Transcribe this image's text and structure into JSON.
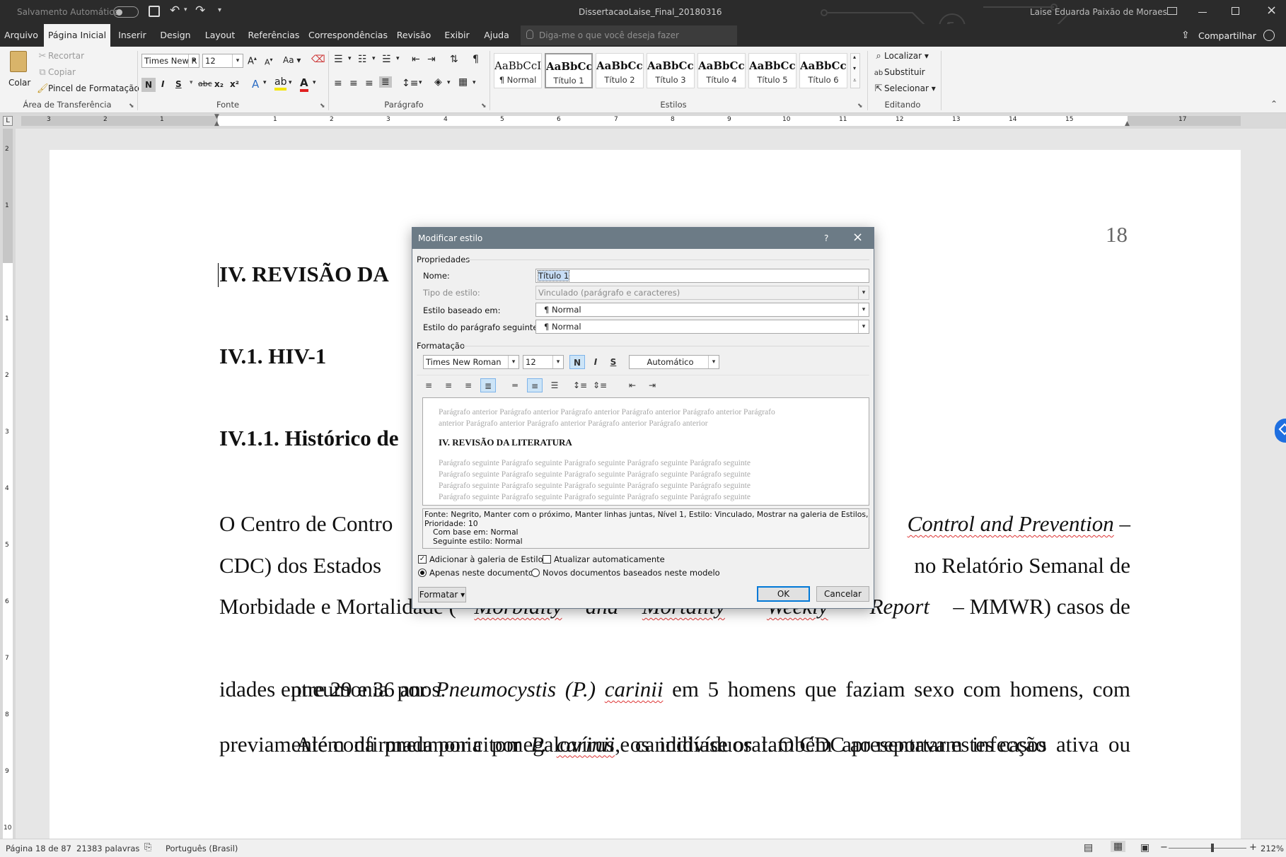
{
  "titlebar": {
    "autosave_label": "Salvamento Automático",
    "autosave_state": "off",
    "doc_title": "DissertacaoLaise_Final_20180316",
    "user_name": "Laise Eduarda Paixão de Moraes"
  },
  "tabs": [
    {
      "label": "Arquivo"
    },
    {
      "label": "Página Inicial"
    },
    {
      "label": "Inserir"
    },
    {
      "label": "Design"
    },
    {
      "label": "Layout"
    },
    {
      "label": "Referências"
    },
    {
      "label": "Correspondências"
    },
    {
      "label": "Revisão"
    },
    {
      "label": "Exibir"
    },
    {
      "label": "Ajuda"
    }
  ],
  "tellme_placeholder": "Diga-me o que você deseja fazer",
  "share_label": "Compartilhar",
  "ribbon": {
    "clipboard": {
      "paste": "Colar",
      "cut": "Recortar",
      "copy": "Copiar",
      "format_painter": "Pincel de Formatação",
      "group": "Área de Transferência"
    },
    "font": {
      "name": "Times New R",
      "size": "12",
      "group": "Fonte",
      "bold": "N",
      "italic": "I",
      "underline": "S",
      "strike": "abc",
      "sub": "x₂",
      "sup": "x²",
      "change_case": "Aa"
    },
    "paragraph": {
      "group": "Parágrafo"
    },
    "styles": {
      "group": "Estilos",
      "items": [
        {
          "preview": "AaBbCcI",
          "name": "¶ Normal"
        },
        {
          "preview": "AaBbCcl",
          "name": "Título 1"
        },
        {
          "preview": "AaBbCcl",
          "name": "Título 2"
        },
        {
          "preview": "AaBbCcl",
          "name": "Título 3"
        },
        {
          "preview": "AaBbCcl",
          "name": "Título 4"
        },
        {
          "preview": "AaBbCcl",
          "name": "Título 5"
        },
        {
          "preview": "AaBbCcl",
          "name": "Título 6"
        }
      ]
    },
    "editing": {
      "group": "Editando",
      "find": "Localizar",
      "replace": "Substituir",
      "select": "Selecionar"
    }
  },
  "ruler": {
    "marks": [
      "3",
      "2",
      "1",
      "1",
      "2",
      "3",
      "4",
      "5",
      "6",
      "7",
      "8",
      "9",
      "10",
      "11",
      "12",
      "13",
      "14",
      "15",
      "17"
    ]
  },
  "vruler": {
    "marks": [
      "2",
      "1",
      "1",
      "2",
      "3",
      "4",
      "5",
      "6",
      "7",
      "8",
      "9",
      "10"
    ]
  },
  "document": {
    "page_number": "18",
    "h1": "IV. REVISÃO DA",
    "h2": "IV.1. HIV-1",
    "h3": "IV.1.1. Histórico de",
    "p1_l1_a": "O Centro de Contro",
    "p1_l1_b": "Control and Prevention",
    "p1_l1_c": " –",
    "p1_l2_a": "CDC) dos Estados",
    "p1_l2_b": "no Relatório Semanal de",
    "p1_l3": [
      "Morbidade e Mortalidade (",
      "Morbidity",
      " and ",
      "Mortality",
      " ",
      "Weekly",
      " ",
      "Report",
      " – MMWR) casos de"
    ],
    "p1_l4": [
      "pneumonia por ",
      "Pneumocystis (P.) ",
      "carinii",
      " em 5 homens que faziam sexo com homens, com"
    ],
    "p1_l5": "idades entre 29 e 36 anos.",
    "p2_l1": [
      "Além da pneumonia por ",
      "P. ",
      "carinii",
      ", os indivíduos também apresentavam infecção ativa ou"
    ],
    "p2_l2": "previamente confirmada por citomegalovírus e candidíase oral. O CDC ao reportar estes casos"
  },
  "dialog": {
    "title": "Modificar estilo",
    "help": "?",
    "section_props": "Propriedades",
    "name_label": "Nome:",
    "name_value": "Título 1",
    "type_label": "Tipo de estilo:",
    "type_value": "Vinculado (parágrafo e caracteres)",
    "based_label": "Estilo baseado em:",
    "based_value": "¶  Normal",
    "next_label": "Estilo do parágrafo seguinte:",
    "next_value": "¶  Normal",
    "section_format": "Formatação",
    "font_value": "Times New Roman",
    "size_value": "12",
    "bold": "N",
    "italic": "I",
    "underline": "S",
    "color_value": "Automático",
    "preview_prev": [
      "Parágrafo anterior Parágrafo anterior Parágrafo anterior Parágrafo anterior Parágrafo anterior Parágrafo",
      "anterior Parágrafo anterior Parágrafo anterior Parágrafo anterior Parágrafo anterior"
    ],
    "preview_heading": "IV. REVISÃO DA LITERATURA",
    "preview_next": [
      "Parágrafo seguinte Parágrafo seguinte Parágrafo seguinte Parágrafo seguinte Parágrafo seguinte",
      "Parágrafo seguinte Parágrafo seguinte Parágrafo seguinte Parágrafo seguinte Parágrafo seguinte",
      "Parágrafo seguinte Parágrafo seguinte Parágrafo seguinte Parágrafo seguinte Parágrafo seguinte",
      "Parágrafo seguinte Parágrafo seguinte Parágrafo seguinte Parágrafo seguinte Parágrafo seguinte"
    ],
    "description_l1": "Fonte: Negrito, Manter com o próximo, Manter linhas juntas, Nível 1, Estilo: Vinculado, Mostrar na galeria de Estilos,",
    "description_l2": "Prioridade: 10",
    "description_l3": "Com base em: Normal",
    "description_l4": "Seguinte estilo: Normal",
    "add_gallery": "Adicionar à galeria de Estilos",
    "add_gallery_checked": true,
    "auto_update": "Atualizar automaticamente",
    "auto_update_checked": false,
    "only_doc": "Apenas neste documento",
    "new_docs": "Novos documentos baseados neste modelo",
    "format_btn": "Formatar",
    "ok": "OK",
    "cancel": "Cancelar"
  },
  "status": {
    "page": "Página 18 de 87",
    "words": "21383 palavras",
    "language": "Português (Brasil)",
    "zoom": "212%",
    "zoom_minus": "−",
    "zoom_plus": "+"
  },
  "colors": {
    "titlebar": "#2b2b2b",
    "ribbon": "#f3f3f3",
    "dialog_title": "#6c7b86",
    "accent": "#0078d7"
  }
}
